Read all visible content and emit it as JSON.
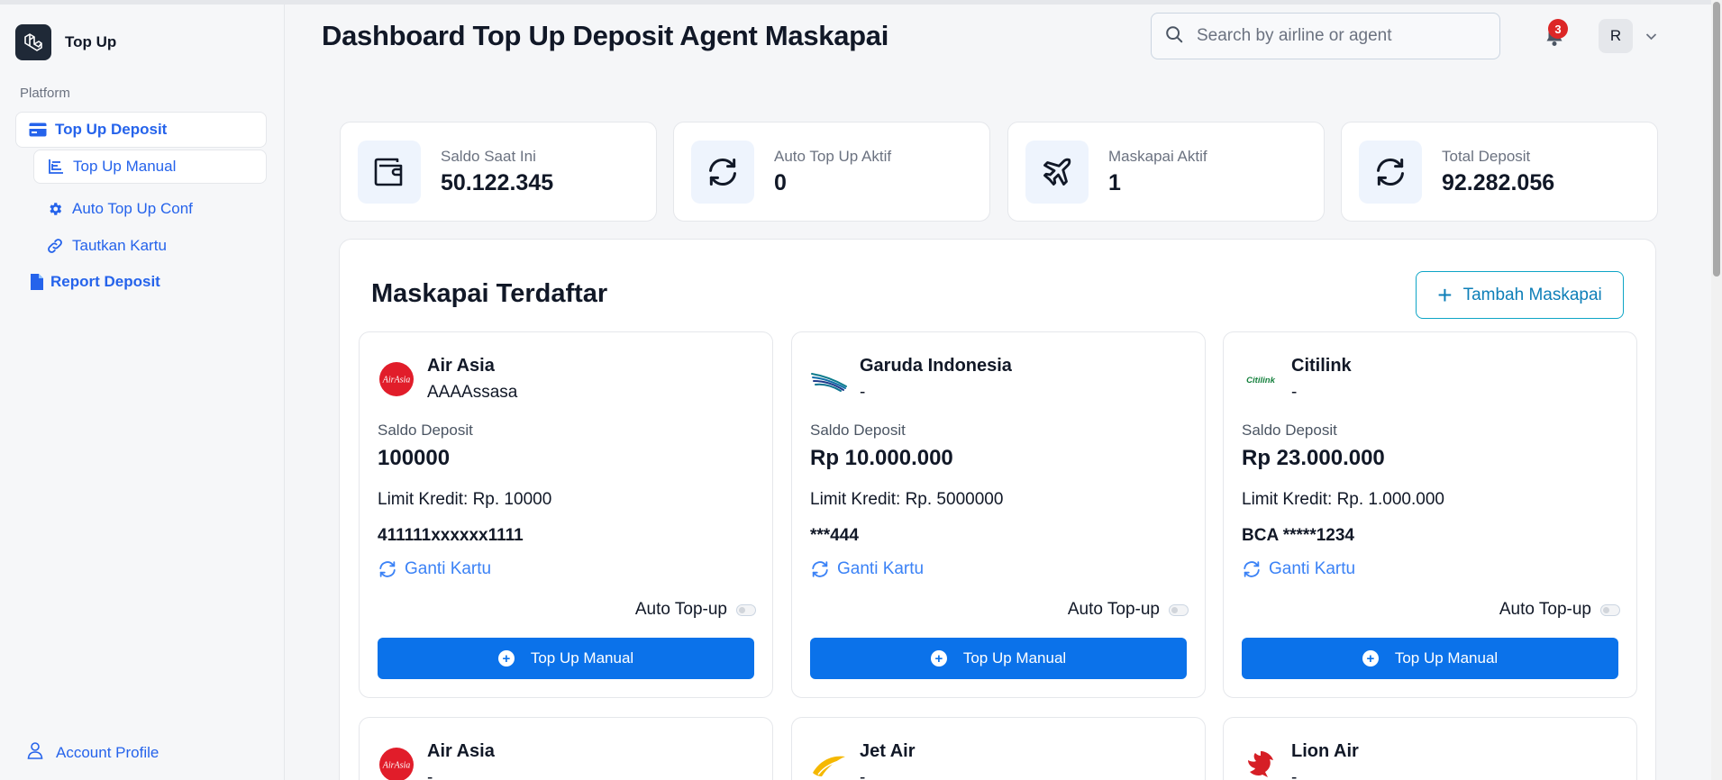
{
  "app": {
    "name": "Top Up"
  },
  "sidebar": {
    "section_label": "Platform",
    "items": [
      {
        "label": "Top Up Deposit",
        "icon": "credit-card-icon"
      },
      {
        "label": "Top Up Manual",
        "icon": "chart-icon"
      },
      {
        "label": "Auto Top Up Conf",
        "icon": "gear-icon"
      },
      {
        "label": "Tautkan Kartu",
        "icon": "link-icon"
      },
      {
        "label": "Report Deposit",
        "icon": "document-icon"
      }
    ],
    "account_label": "Account Profile"
  },
  "header": {
    "title": "Dashboard Top Up Deposit Agent Maskapai",
    "search_placeholder": "Search by airline or agent",
    "notification_count": "3",
    "avatar_initial": "R"
  },
  "stats": [
    {
      "label": "Saldo Saat Ini",
      "value": "50.122.345",
      "icon": "wallet-icon"
    },
    {
      "label": "Auto Top Up Aktif",
      "value": "0",
      "icon": "refresh-icon"
    },
    {
      "label": "Maskapai Aktif",
      "value": "1",
      "icon": "plane-icon"
    },
    {
      "label": "Total Deposit",
      "value": "92.282.056",
      "icon": "refresh-icon"
    }
  ],
  "panel": {
    "title": "Maskapai Terdaftar",
    "add_button": "Tambah Maskapai",
    "saldo_label": "Saldo Deposit",
    "ganti_label": "Ganti Kartu",
    "auto_label": "Auto Top-up",
    "topup_label": "Top Up Manual"
  },
  "airlines": [
    {
      "name": "Air Asia",
      "sub": "AAAAssasa",
      "saldo": "100000",
      "limit": "Limit Kredit: Rp. 10000",
      "card": "411111xxxxxx1111",
      "logo_text": "AirAsia",
      "auto_topup": false
    },
    {
      "name": "Garuda Indonesia",
      "sub": "-",
      "saldo": "Rp 10.000.000",
      "limit": "Limit Kredit: Rp. 5000000",
      "card": "***444",
      "auto_topup": false
    },
    {
      "name": "Citilink",
      "sub": "-",
      "saldo": "Rp 23.000.000",
      "limit": "Limit Kredit: Rp. 1.000.000",
      "card": "BCA *****1234",
      "logo_text": "Citilink",
      "auto_topup": false
    },
    {
      "name": "Air Asia",
      "sub": "-",
      "logo_text": "AirAsia"
    },
    {
      "name": "Jet Air",
      "sub": "-"
    },
    {
      "name": "Lion Air",
      "sub": "-"
    }
  ],
  "colors": {
    "primary": "#0b72ea",
    "link": "#2563eb",
    "badge": "#dc2626"
  }
}
